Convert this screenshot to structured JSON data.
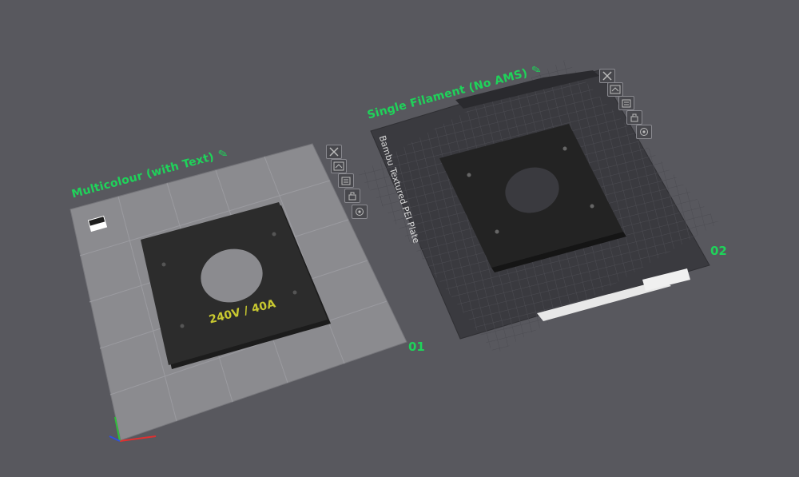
{
  "plates": [
    {
      "title": "Multicolour (with Text)",
      "number": "01",
      "part_label": "240V  / 40A",
      "tools": [
        "close-icon",
        "arrange-icon",
        "lock-icon",
        "unlock-icon",
        "settings-icon"
      ]
    },
    {
      "title": "Single Filament (No AMS)",
      "number": "02",
      "bed_label": "Bambu Textured PEI Plate",
      "tools": [
        "close-icon",
        "arrange-icon",
        "lock-icon",
        "unlock-icon",
        "settings-icon"
      ]
    }
  ],
  "colors": {
    "background": "#58585e",
    "accent": "#1fd35a",
    "part": "#2b2b2b",
    "text_on_part": "#c9c930"
  }
}
